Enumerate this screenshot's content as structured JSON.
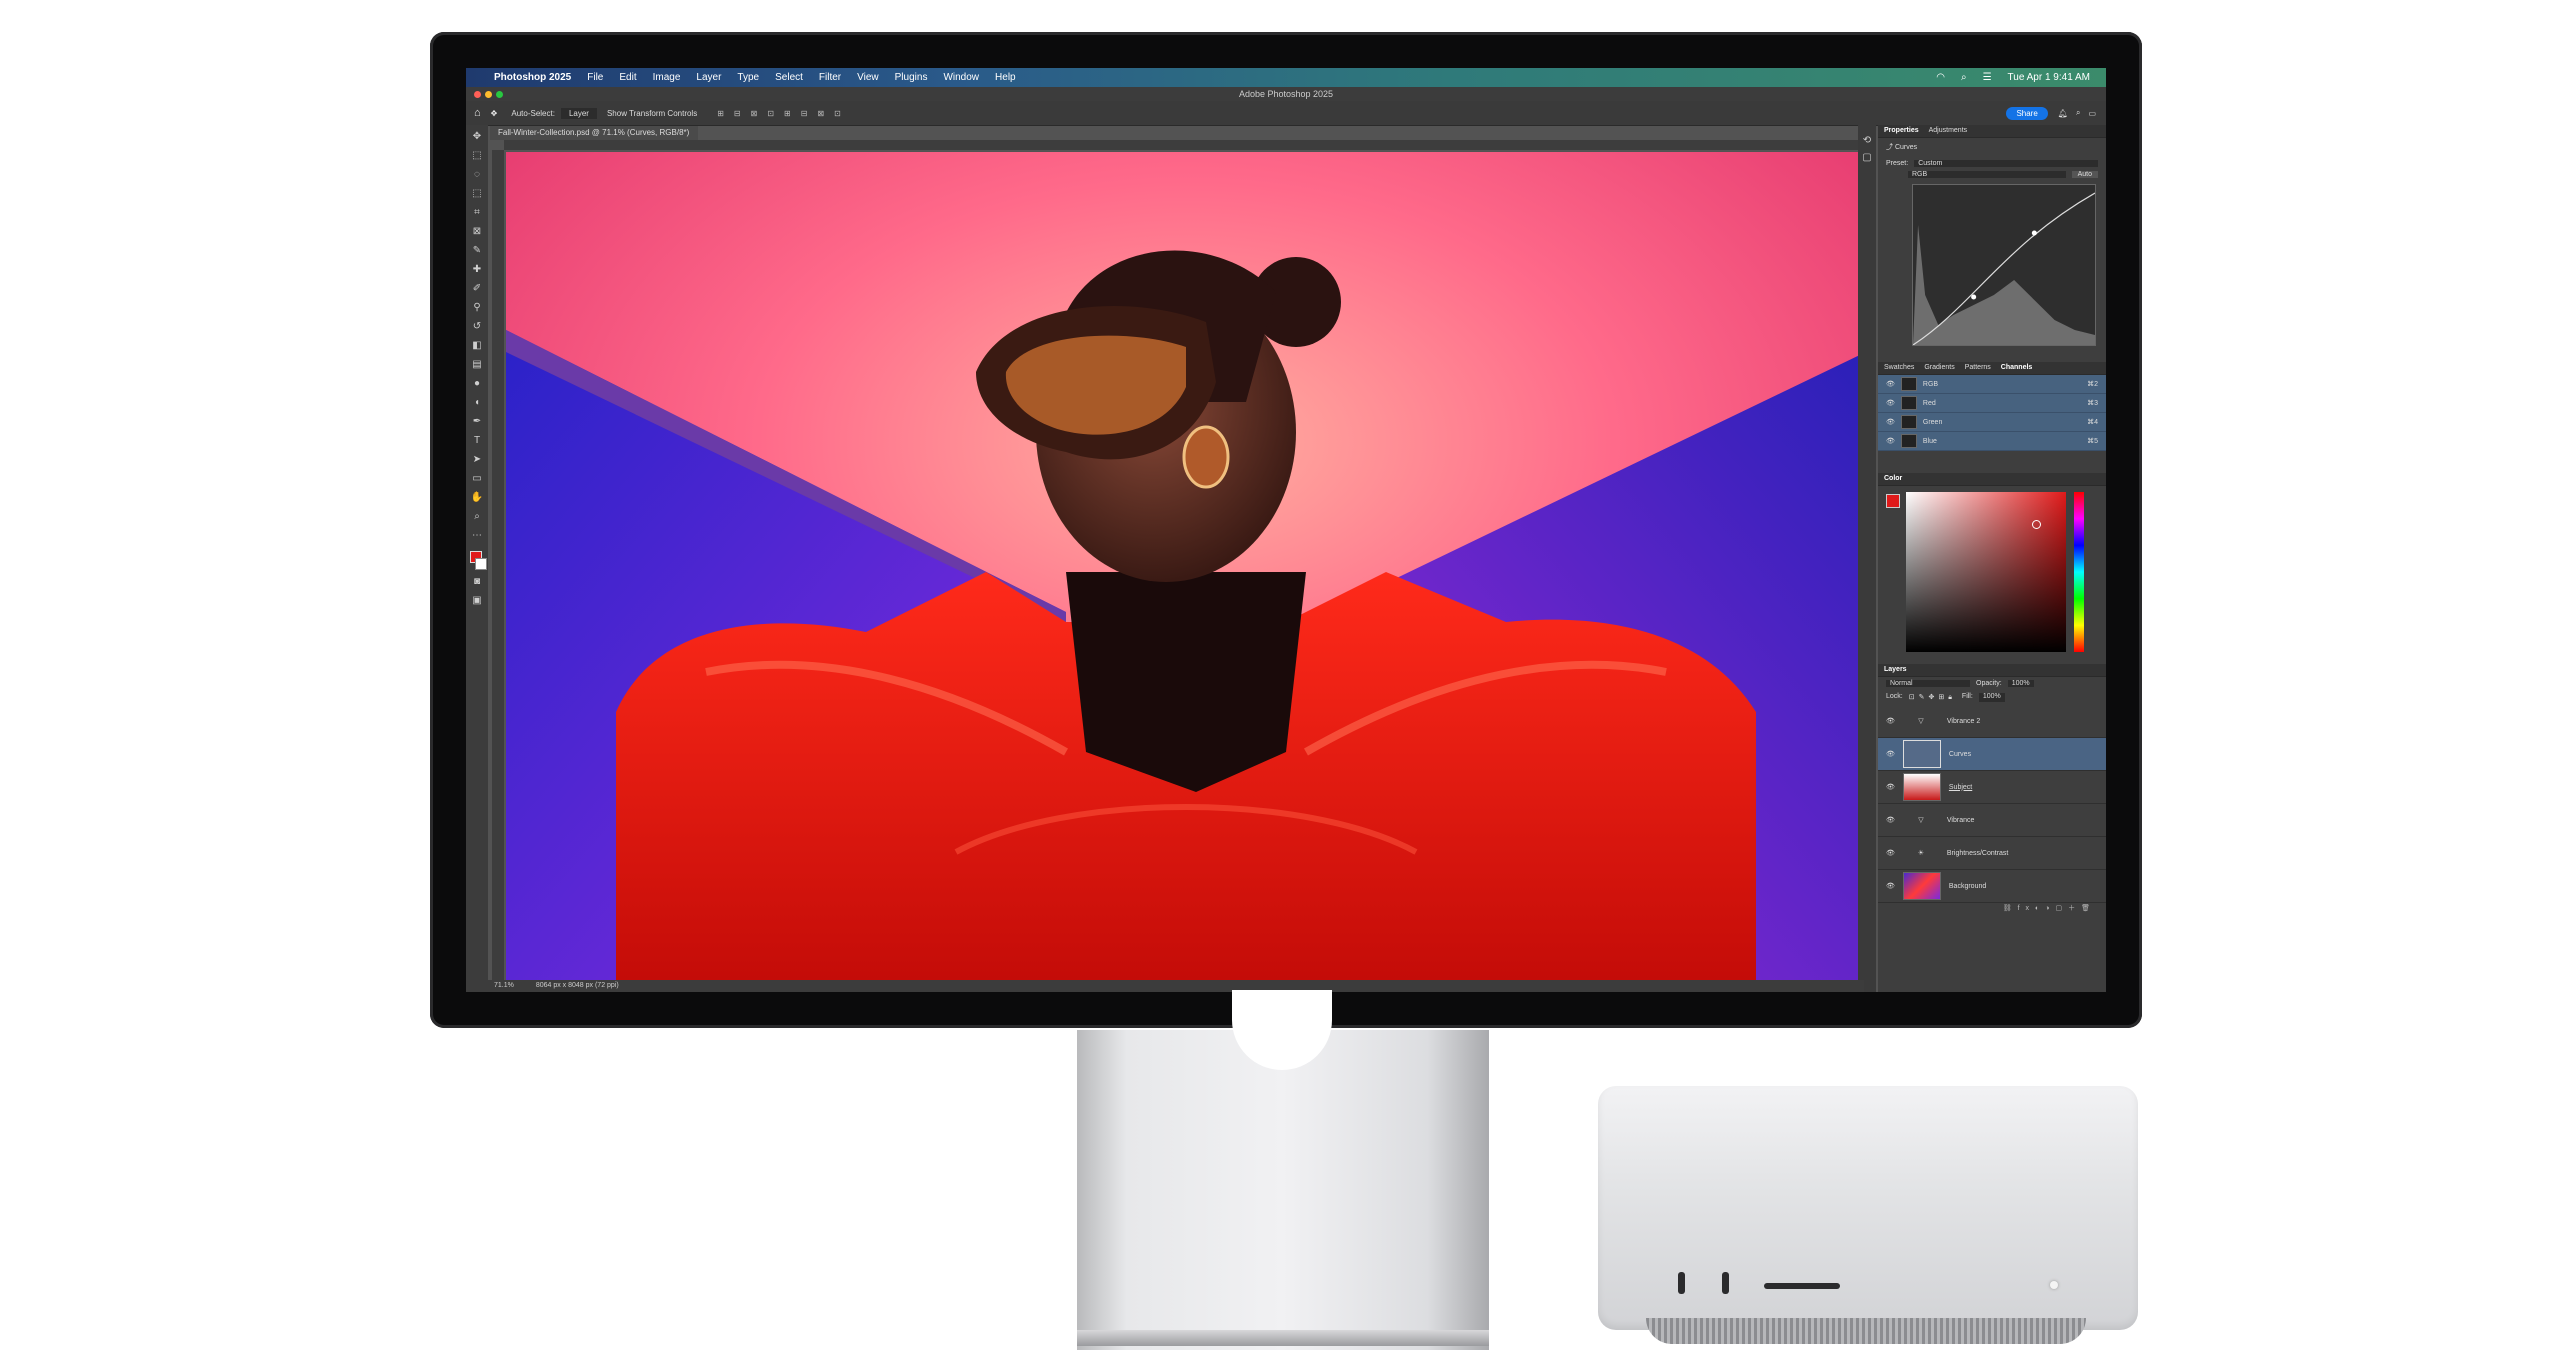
{
  "menubar": {
    "app_name": "Photoshop 2025",
    "items": [
      "File",
      "Edit",
      "Image",
      "Layer",
      "Type",
      "Select",
      "Filter",
      "View",
      "Plugins",
      "Window",
      "Help"
    ],
    "clock": "Tue Apr 1  9:41 AM"
  },
  "window": {
    "title": "Adobe Photoshop 2025"
  },
  "options_bar": {
    "auto_select_label": "Auto-Select:",
    "auto_select_value": "Layer",
    "transform_label": "Show Transform Controls",
    "share_label": "Share"
  },
  "document": {
    "tab_label": "Fall-Winter-Collection.psd @ 71.1% (Curves, RGB/8*)"
  },
  "status": {
    "zoom": "71.1%",
    "size": "8064 px x 8048 px (72 ppi)"
  },
  "properties": {
    "tabs": [
      "Properties",
      "Adjustments"
    ],
    "adjustment": "Curves",
    "preset_label": "Preset:",
    "preset_value": "Custom",
    "channel_value": "RGB",
    "auto_label": "Auto"
  },
  "channels_panel": {
    "tabs": [
      "Swatches",
      "Gradients",
      "Patterns",
      "Channels"
    ],
    "channels": [
      {
        "name": "RGB",
        "shortcut": "⌘2"
      },
      {
        "name": "Red",
        "shortcut": "⌘3"
      },
      {
        "name": "Green",
        "shortcut": "⌘4"
      },
      {
        "name": "Blue",
        "shortcut": "⌘5"
      }
    ]
  },
  "color_panel": {
    "title": "Color",
    "foreground": "#e01a1a"
  },
  "layers_panel": {
    "title": "Layers",
    "blend_mode": "Normal",
    "opacity_label": "Opacity:",
    "opacity_value": "100%",
    "lock_label": "Lock:",
    "fill_label": "Fill:",
    "fill_value": "100%",
    "layers": [
      {
        "name": "Vibrance 2",
        "selected": false
      },
      {
        "name": "Curves",
        "selected": true
      },
      {
        "name": "Subject",
        "selected": false
      },
      {
        "name": "Vibrance",
        "selected": false
      },
      {
        "name": "Brightness/Contrast",
        "selected": false
      },
      {
        "name": "Background",
        "selected": false
      }
    ]
  },
  "colors": {
    "accent": "#1473e6",
    "selection": "#4a6484"
  }
}
